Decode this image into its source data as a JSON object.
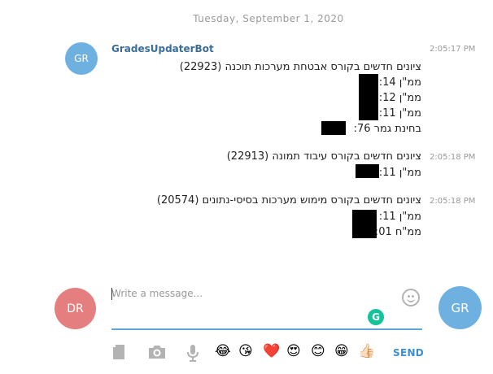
{
  "chat": {
    "date_separator": "Tuesday, September 1, 2020",
    "bot_avatar_initials": "GR",
    "sender_name": "GradesUpdaterBot",
    "messages": [
      {
        "timestamp": "2:05:17 PM",
        "lines": [
          "ציונים חדשים בקורס אבטחת מערכות תוכנה (22923)",
          "ממ\"ן 14:",
          "ממ\"ן 12:",
          "ממ\"ן 11:",
          "בחינת גמר   76:"
        ]
      },
      {
        "timestamp": "2:05:18 PM",
        "lines": [
          "ציונים חדשים בקורס עיבוד תמונה (22913)",
          "ממ\"ן 11:"
        ]
      },
      {
        "timestamp": "2:05:18 PM",
        "lines": [
          "ציונים חדשים בקורס מימוש מערכות בסיסי-נתונים (20574)",
          "ממ\"ן 11:",
          "ממ\"ח 01:"
        ]
      }
    ]
  },
  "composer": {
    "placeholder": "Write a message...",
    "my_avatar_initials": "DR",
    "peer_avatar_initials": "GR",
    "grammarly_letter": "G",
    "send_label": "SEND",
    "quick_emojis": [
      "😂",
      "😘",
      "❤️",
      "😍",
      "😊",
      "😁",
      "👍🏻"
    ],
    "accent_color": "#5fa7d8"
  }
}
